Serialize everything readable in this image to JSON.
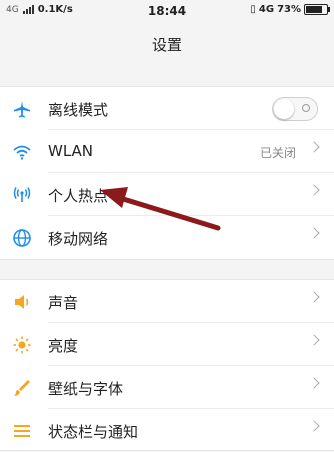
{
  "statusbar": {
    "carrier": "4G",
    "speed": "0.1K/s",
    "time": "18:44",
    "network": "4G",
    "battery_text": "73%",
    "battery_level": 0.73
  },
  "header": {
    "title": "设置"
  },
  "groups": [
    {
      "items": [
        {
          "label": "离线模式",
          "icon": "airplane-icon"
        },
        {
          "label": "WLAN",
          "value": "已关闭",
          "icon": "wifi-icon"
        },
        {
          "label": "个人热点",
          "icon": "hotspot-icon"
        },
        {
          "label": "移动网络",
          "icon": "globe-icon"
        }
      ]
    },
    {
      "items": [
        {
          "label": "声音",
          "icon": "speaker-icon"
        },
        {
          "label": "亮度",
          "icon": "brightness-icon"
        },
        {
          "label": "壁纸与字体",
          "icon": "brush-icon"
        },
        {
          "label": "状态栏与通知",
          "icon": "list-icon"
        }
      ]
    }
  ],
  "colors": {
    "accent_blue": "#1e8fe8",
    "accent_orange": "#f5a623",
    "arrow": "#8b1a1a"
  }
}
